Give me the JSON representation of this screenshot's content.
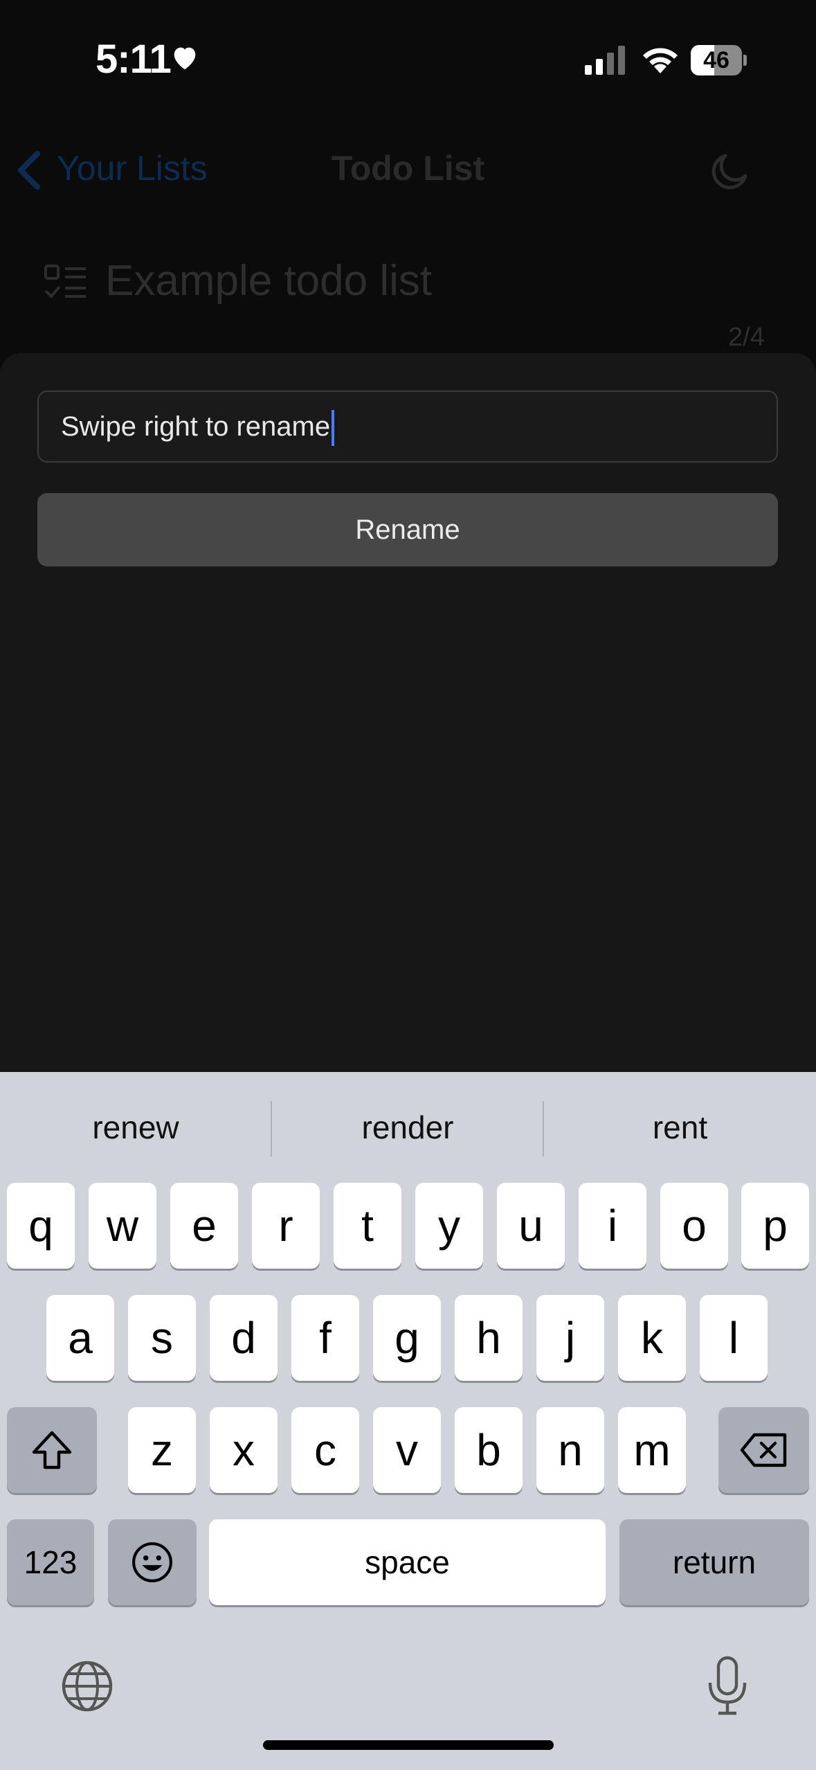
{
  "status_bar": {
    "time": "5:11",
    "battery": "46"
  },
  "nav": {
    "back_label": "Your Lists",
    "title": "Todo List"
  },
  "list": {
    "title": "Example todo list",
    "count": "2/4"
  },
  "sheet": {
    "input_value": "Swipe right to rename",
    "button_label": "Rename"
  },
  "keyboard": {
    "suggestions": [
      "renew",
      "render",
      "rent"
    ],
    "row1": [
      "q",
      "w",
      "e",
      "r",
      "t",
      "y",
      "u",
      "i",
      "o",
      "p"
    ],
    "row2": [
      "a",
      "s",
      "d",
      "f",
      "g",
      "h",
      "j",
      "k",
      "l"
    ],
    "row3": [
      "z",
      "x",
      "c",
      "v",
      "b",
      "n",
      "m"
    ],
    "numbers_label": "123",
    "space_label": "space",
    "return_label": "return"
  }
}
